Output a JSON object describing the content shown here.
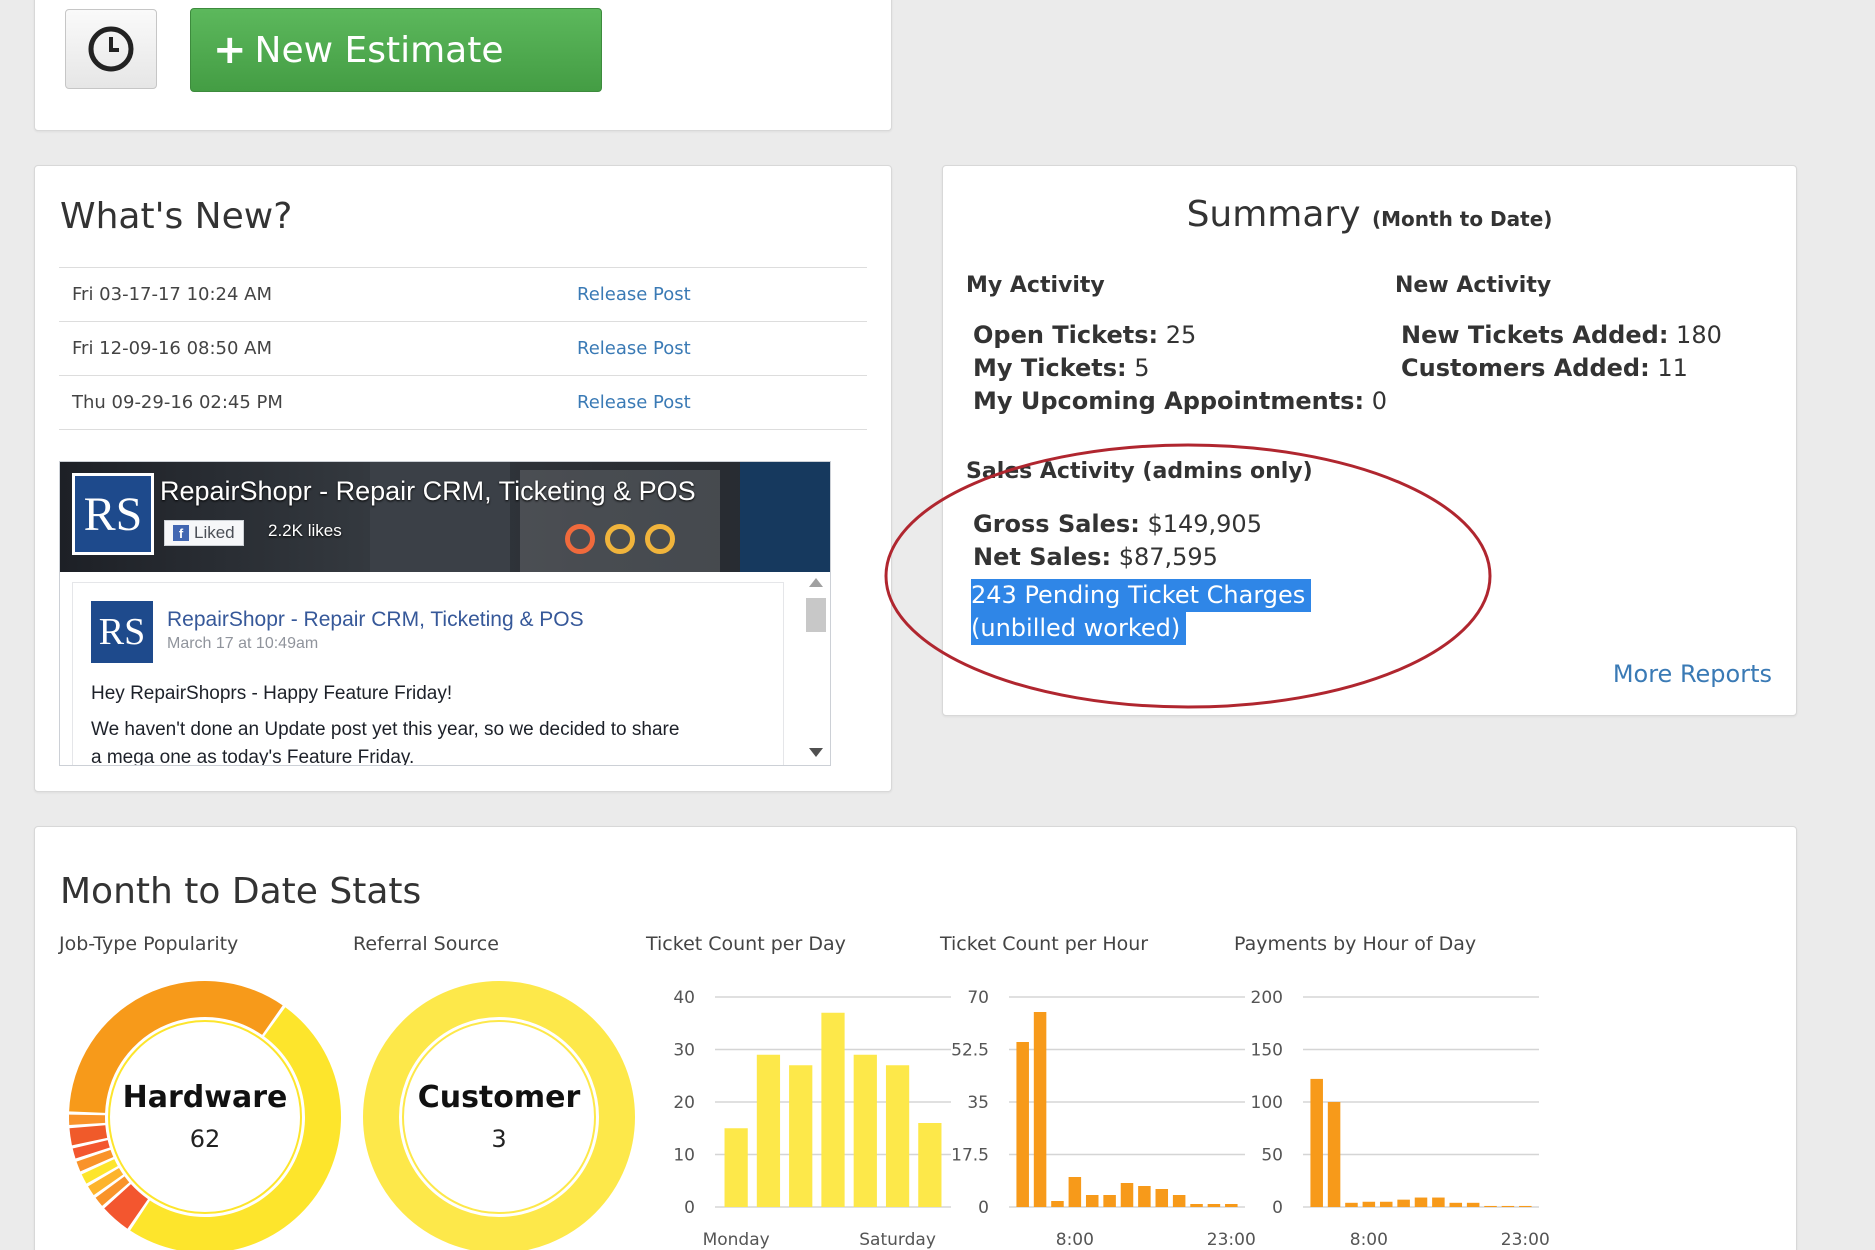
{
  "toolbar": {
    "clock_icon": "clock-icon",
    "new_estimate_plus": "+",
    "new_estimate_label": "New Estimate",
    "accent_color": "#5cb85c"
  },
  "whats_new": {
    "title": "What's New?",
    "releases": [
      {
        "date": "Fri 03-17-17 10:24 AM",
        "link": "Release Post"
      },
      {
        "date": "Fri 12-09-16 08:50 AM",
        "link": "Release Post"
      },
      {
        "date": "Thu 09-29-16 02:45 PM",
        "link": "Release Post"
      }
    ],
    "facebook": {
      "logo_text": "RS",
      "page_name": "RepairShopr - Repair CRM, Ticketing & POS",
      "liked_label": "Liked",
      "likes": "2.2K likes",
      "post_author": "RepairShopr - Repair CRM, Ticketing & POS",
      "post_time": "March 17 at 10:49am",
      "post_line1": "Hey RepairShoprs - Happy Feature Friday!",
      "post_line2": "We haven't done an Update post yet this year, so we decided to share",
      "post_line3": "a mega one as today's Feature Friday."
    }
  },
  "summary": {
    "title": "Summary",
    "subtitle": "(Month to Date)",
    "my_activity": {
      "title": "My Activity",
      "items": [
        {
          "label": "Open Tickets:",
          "value": " 25"
        },
        {
          "label": "My Tickets:",
          "value": " 5"
        },
        {
          "label": "My Upcoming Appointments:",
          "value": " 0"
        }
      ]
    },
    "new_activity": {
      "title": "New Activity",
      "items": [
        {
          "label": "New Tickets Added:",
          "value": " 180"
        },
        {
          "label": "Customers Added:",
          "value": " 11"
        }
      ]
    },
    "sales_activity": {
      "title": "Sales Activity (admins only)",
      "items": [
        {
          "label": "Gross Sales:",
          "value": " $149,905"
        },
        {
          "label": "Net Sales:",
          "value": " $87,595"
        }
      ],
      "pending_line1": "243 Pending Ticket Charges",
      "pending_line2": "(unbilled worked)"
    },
    "more_reports": "More Reports",
    "highlight_color": "#2f86e7",
    "annotation_color": "#b0262f"
  },
  "stats": {
    "title": "Month to Date Stats",
    "chart_labels": [
      "Job-Type Popularity",
      "Referral Source",
      "Ticket Count per Day",
      "Ticket Count per Hour",
      "Payments by Hour of Day"
    ]
  },
  "chart_data": [
    {
      "type": "pie",
      "title": "Job-Type Popularity",
      "center_label": "Hardware",
      "center_value": "62",
      "slices": [
        {
          "value": 62,
          "color": "#fde52c"
        },
        {
          "value": 5,
          "color": "#f3562f"
        },
        {
          "value": 2,
          "color": "#f9932a"
        },
        {
          "value": 2,
          "color": "#fdb42b"
        },
        {
          "value": 2,
          "color": "#fde52c"
        },
        {
          "value": 2,
          "color": "#f9932a"
        },
        {
          "value": 2,
          "color": "#f3562f"
        },
        {
          "value": 3,
          "color": "#f05a2a"
        },
        {
          "value": 2,
          "color": "#f9932a"
        },
        {
          "value": 43,
          "color": "#f79a1a"
        }
      ]
    },
    {
      "type": "pie",
      "title": "Referral Source",
      "center_label": "Customer",
      "center_value": "3",
      "slices": [
        {
          "value": 3,
          "color": "#fde84a"
        }
      ]
    },
    {
      "type": "bar",
      "title": "Ticket Count per Day",
      "color": "#fde84a",
      "ylim": [
        0,
        40
      ],
      "yticks": [
        "0",
        "10",
        "20",
        "30",
        "40"
      ],
      "values": [
        15,
        29,
        27,
        37,
        29,
        27,
        16
      ],
      "xlabels": [
        {
          "index": 0,
          "text": "Monday"
        },
        {
          "index": 5,
          "text": "Saturday"
        }
      ]
    },
    {
      "type": "bar",
      "title": "Ticket Count per Hour",
      "color": "#f79a1a",
      "ylim": [
        0,
        70
      ],
      "yticks": [
        "0",
        "17.5",
        "35",
        "52.5",
        "70"
      ],
      "values": [
        55,
        65,
        2,
        10,
        4,
        4,
        8,
        7,
        6,
        4,
        1,
        1,
        1
      ],
      "xlabels": [
        {
          "index": 3,
          "text": "8:00"
        },
        {
          "index": 12,
          "text": "23:00"
        }
      ]
    },
    {
      "type": "bar",
      "title": "Payments by Hour of Day",
      "color": "#f79a1a",
      "ylim": [
        0,
        200
      ],
      "yticks": [
        "0",
        "50",
        "100",
        "150",
        "200"
      ],
      "values": [
        122,
        100,
        4,
        5,
        5,
        7,
        9,
        9,
        4,
        4,
        1,
        1,
        1
      ],
      "xlabels": [
        {
          "index": 3,
          "text": "8:00"
        },
        {
          "index": 12,
          "text": "23:00"
        }
      ]
    }
  ]
}
